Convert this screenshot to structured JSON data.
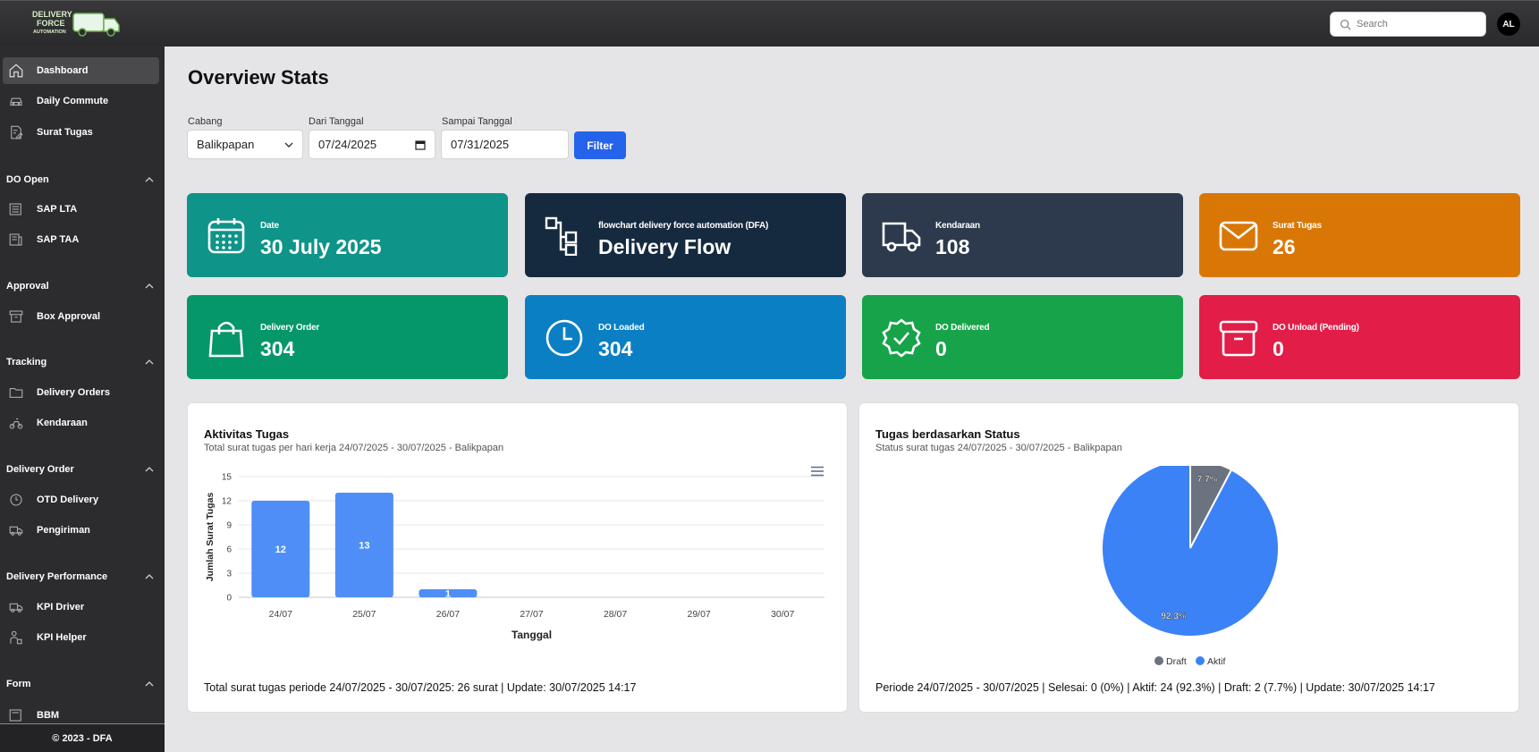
{
  "header": {
    "logo_line1": "DELIVERY",
    "logo_line2": "FORCE",
    "logo_line3": "AUTOMATION",
    "search_placeholder": "Search",
    "avatar_initials": "AL"
  },
  "sidebar": {
    "items": [
      {
        "label": "Dashboard",
        "icon": "home-icon"
      },
      {
        "label": "Daily Commute",
        "icon": "car-icon"
      },
      {
        "label": "Surat Tugas",
        "icon": "edit-document-icon"
      },
      {
        "label": "SAP LTA",
        "icon": "newspaper-icon"
      },
      {
        "label": "SAP TAA",
        "icon": "newspaper-icon"
      },
      {
        "label": "Box Approval",
        "icon": "archive-icon"
      },
      {
        "label": "Delivery Orders",
        "icon": "folder-icon"
      },
      {
        "label": "Kendaraan",
        "icon": "scooter-icon"
      },
      {
        "label": "OTD Delivery",
        "icon": "clock-icon"
      },
      {
        "label": "Pengiriman",
        "icon": "truck-icon"
      },
      {
        "label": "KPI Driver",
        "icon": "truck-icon"
      },
      {
        "label": "KPI Helper",
        "icon": "person-icon"
      },
      {
        "label": "BBM",
        "icon": "newspaper-icon"
      }
    ],
    "sections": [
      "DO Open",
      "Approval",
      "Tracking",
      "Delivery Order",
      "Delivery Performance",
      "Form"
    ],
    "footer": "© 2023 - DFA"
  },
  "main": {
    "title": "Overview Stats",
    "filters": {
      "cabang_label": "Cabang",
      "cabang_value": "Balikpapan",
      "dari_label": "Dari Tanggal",
      "dari_value": "07/24/2025",
      "sampai_label": "Sampai Tanggal",
      "sampai_value": "07/31/2025",
      "filter_button": "Filter"
    },
    "cards": [
      {
        "label": "Date",
        "value": "30 July 2025",
        "color": "#0e9488",
        "icon": "calendar-icon"
      },
      {
        "label": "flowchart delivery force automation (DFA)",
        "value": "Delivery Flow",
        "color": "#152a3e",
        "icon": "flowchart-icon"
      },
      {
        "label": "Kendaraan",
        "value": "108",
        "color": "#2d3a4e",
        "icon": "truck-icon"
      },
      {
        "label": "Surat Tugas",
        "value": "26",
        "color": "#d97706",
        "icon": "mail-icon"
      },
      {
        "label": "Delivery Order",
        "value": "304",
        "color": "#059669",
        "icon": "shopping-bag-icon"
      },
      {
        "label": "DO Loaded",
        "value": "304",
        "color": "#0b7fc4",
        "icon": "clock-icon"
      },
      {
        "label": "DO Delivered",
        "value": "0",
        "color": "#16a34a",
        "icon": "badge-check-icon"
      },
      {
        "label": "DO Unload (Pending)",
        "value": "0",
        "color": "#e11d48",
        "icon": "archive-icon"
      }
    ],
    "bar_panel": {
      "title": "Aktivitas Tugas",
      "subtitle": "Total surat tugas per hari kerja 24/07/2025 - 30/07/2025 - Balikpapan",
      "footer": "Total surat tugas periode 24/07/2025 - 30/07/2025: 26 surat | Update: 30/07/2025 14:17"
    },
    "pie_panel": {
      "title": "Tugas berdasarkan Status",
      "subtitle": "Status surat tugas 24/07/2025 - 30/07/2025 - Balikpapan",
      "footer": "Periode 24/07/2025 - 30/07/2025 | Selesai: 0 (0%) | Aktif: 24 (92.3%) | Draft: 2 (7.7%) | Update: 30/07/2025 14:17"
    }
  },
  "chart_data": [
    {
      "type": "bar",
      "categories": [
        "24/07",
        "25/07",
        "26/07",
        "27/07",
        "28/07",
        "29/07",
        "30/07"
      ],
      "values": [
        12,
        13,
        1,
        0,
        0,
        0,
        0
      ],
      "data_labels": [
        "12",
        "13",
        "1"
      ],
      "xlabel": "Tanggal",
      "ylabel": "Jumlah Surat Tugas",
      "ylim": [
        0,
        15
      ],
      "yticks": [
        "0",
        "3",
        "6",
        "9",
        "12",
        "15"
      ],
      "color": "#4f8ef7",
      "grid": true
    },
    {
      "type": "pie",
      "slices": [
        {
          "name": "Draft",
          "value": 7.7,
          "label": "7.7%",
          "color": "#6b7280"
        },
        {
          "name": "Aktif",
          "value": 92.3,
          "label": "92.3%",
          "color": "#3b82f6"
        }
      ],
      "legend_placement": "bottom"
    }
  ]
}
